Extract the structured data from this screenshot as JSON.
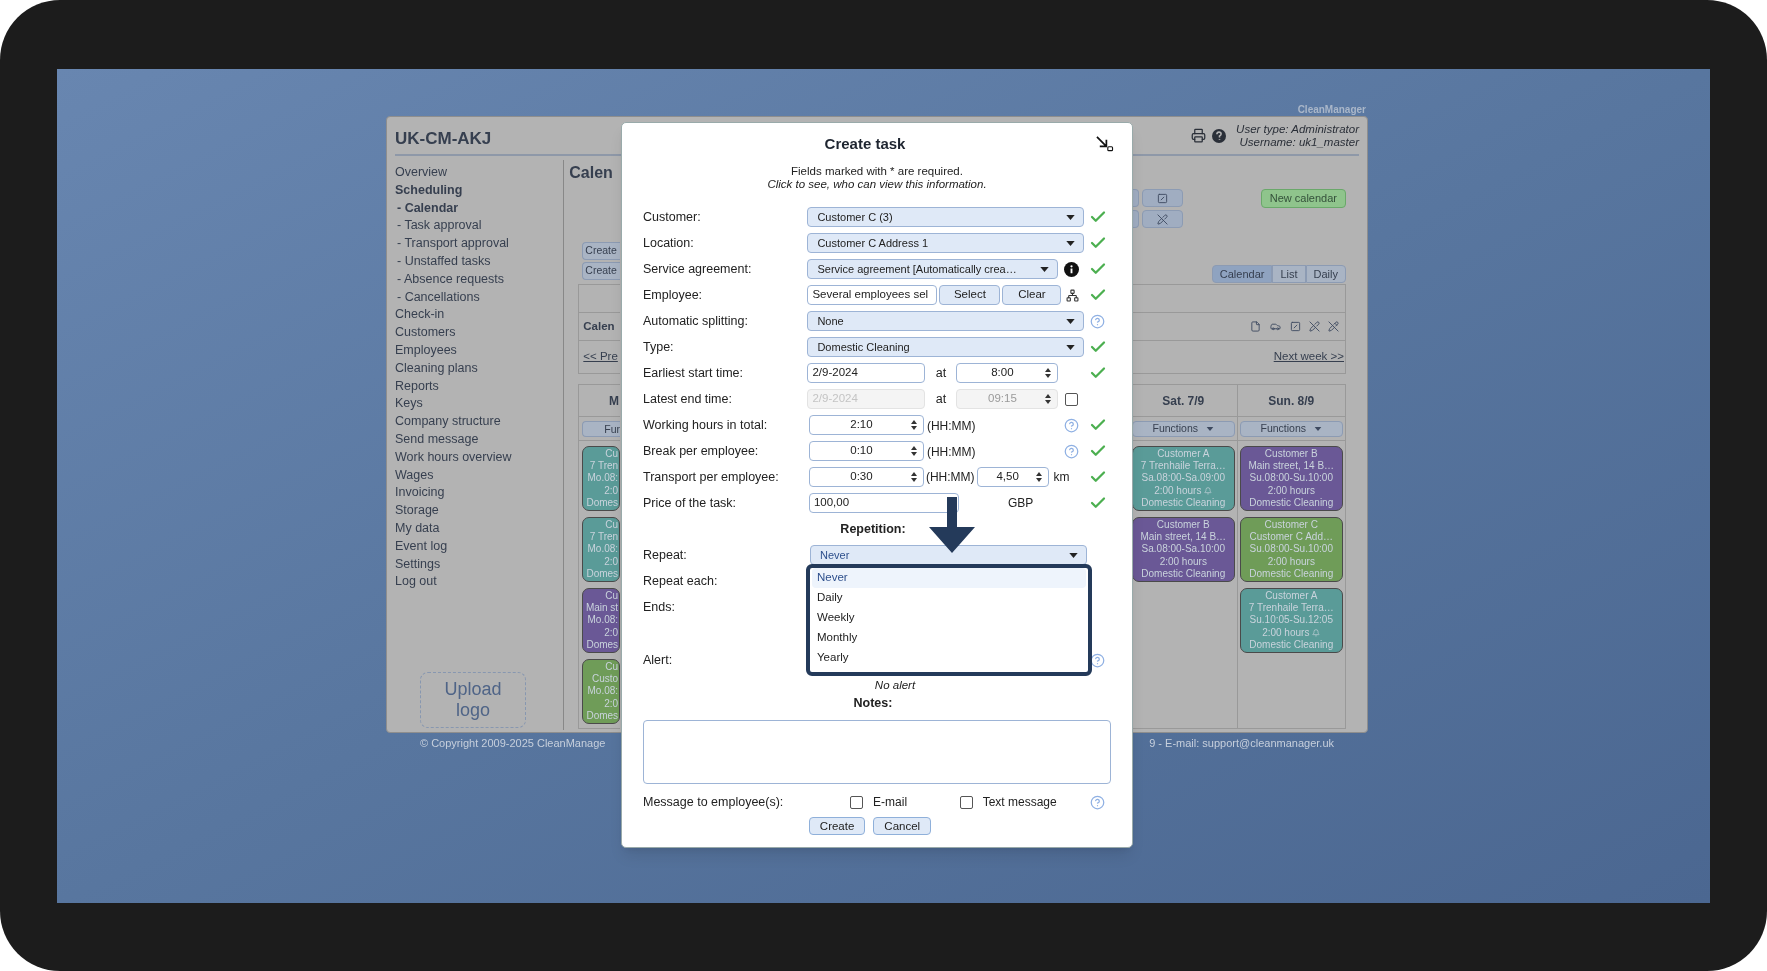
{
  "brand": "CleanManager",
  "app": {
    "title": "UK-CM-AKJ",
    "user_type": "User type: Administrator",
    "username": "Username: uk1_master"
  },
  "sidebar": {
    "items": [
      {
        "label": "Overview",
        "selected": false
      },
      {
        "label": "Scheduling",
        "selected": true,
        "children": [
          {
            "label": "- Calendar",
            "selected": true
          },
          {
            "label": "- Task approval",
            "selected": false
          },
          {
            "label": "- Transport approval",
            "selected": false
          },
          {
            "label": "- Unstaffed tasks",
            "selected": false
          },
          {
            "label": "- Absence requests",
            "selected": false
          },
          {
            "label": "- Cancellations",
            "selected": false
          }
        ]
      },
      {
        "label": "Check-in",
        "selected": false
      },
      {
        "label": "Customers",
        "selected": false
      },
      {
        "label": "Employees",
        "selected": false
      },
      {
        "label": "Cleaning plans",
        "selected": false
      },
      {
        "label": "Reports",
        "selected": false
      },
      {
        "label": "Keys",
        "selected": false
      },
      {
        "label": "Company structure",
        "selected": false
      },
      {
        "label": "Send message",
        "selected": false
      },
      {
        "label": "Work hours overview",
        "selected": false
      },
      {
        "label": "Wages",
        "selected": false
      },
      {
        "label": "Invoicing",
        "selected": false
      },
      {
        "label": "Storage",
        "selected": false
      },
      {
        "label": "My data",
        "selected": false
      },
      {
        "label": "Event log",
        "selected": false
      },
      {
        "label": "Settings",
        "selected": false
      },
      {
        "label": "Log out",
        "selected": false
      }
    ],
    "upload_logo": "Upload logo"
  },
  "calendar_left": {
    "heading": "Calen",
    "create_buttons": [
      "Create",
      "Create"
    ],
    "box_title": "Calen",
    "prev_link": "<< Pre",
    "day_header": "M",
    "functions": "Fur",
    "cards": [
      {
        "name": "Cu",
        "address": "7 Tren",
        "time": "Mo.08:",
        "hours": "2:0",
        "type": "Domes",
        "color": "#5a9b98"
      },
      {
        "name": "Cu",
        "address": "7 Tren",
        "time": "Mo.08:",
        "hours": "2:0",
        "type": "Domes",
        "color": "#5a9b98"
      },
      {
        "name": "Cu",
        "address": "Main st",
        "time": "Mo.08:",
        "hours": "2:0",
        "type": "Domes",
        "color": "#6a5896"
      },
      {
        "name": "Cu",
        "address": "Custo",
        "time": "Mo.08:",
        "hours": "2:0",
        "type": "Domes",
        "color": "#6f9c58"
      }
    ]
  },
  "calendar_right": {
    "new_calendar": "New calendar",
    "view_tabs": [
      {
        "label": "Calendar",
        "selected": true
      },
      {
        "label": "List",
        "selected": false
      },
      {
        "label": "Daily",
        "selected": false
      }
    ],
    "next_link": "Next week >>",
    "days": [
      {
        "header": "Sat. 7/9",
        "functions": "Functions",
        "cards": [
          {
            "name": "Customer A",
            "address": "7 Trenhaile Terra…",
            "time": "Sa.08:00-Sa.09:00",
            "hours": "2:00 hours",
            "alert": true,
            "type": "Domestic Cleaning",
            "color": "#5a9b98"
          },
          {
            "name": "Customer B",
            "address": "Main street, 14 B…",
            "time": "Sa.08:00-Sa.10:00",
            "hours": "2:00 hours",
            "alert": false,
            "type": "Domestic Cleaning",
            "color": "#6a5896"
          }
        ]
      },
      {
        "header": "Sun. 8/9",
        "functions": "Functions",
        "cards": [
          {
            "name": "Customer B",
            "address": "Main street, 14 B…",
            "time": "Su.08:00-Su.10:00",
            "hours": "2:00 hours",
            "alert": false,
            "type": "Domestic Cleaning",
            "color": "#6a5896"
          },
          {
            "name": "Customer C",
            "address": "Customer C Add…",
            "time": "Su.08:00-Su.10:00",
            "hours": "2:00 hours",
            "alert": false,
            "type": "Domestic Cleaning",
            "color": "#6f9c58"
          },
          {
            "name": "Customer A",
            "address": "7 Trenhaile Terra…",
            "time": "Su.10:05-Su.12:05",
            "hours": "2:00 hours",
            "alert": true,
            "type": "Domestic Cleaning",
            "color": "#5a9b98"
          }
        ]
      }
    ]
  },
  "footer": {
    "left": "© Copyright 2009-2025 CleanManage",
    "right": "9 - E-mail: support@cleanmanager.uk"
  },
  "dialog": {
    "title": "Create task",
    "note": "Fields marked with * are required.",
    "note_italic": "Click to see, who can view this information.",
    "fields": [
      {
        "kind": "select",
        "label": "Customer:",
        "value": "Customer C (3)",
        "info": false,
        "help": false,
        "valid": true
      },
      {
        "kind": "select",
        "label": "Location:",
        "value": "Customer C Address 1",
        "info": false,
        "help": false,
        "valid": true
      },
      {
        "kind": "select",
        "label": "Service agreement:",
        "value": "Service agreement [Automatically crea…",
        "info": true,
        "help": false,
        "valid": true
      },
      {
        "kind": "employee",
        "label": "Employee:",
        "value": "Several employees sel",
        "buttons": [
          "Select",
          "Clear"
        ],
        "valid": true
      },
      {
        "kind": "select",
        "label": "Automatic splitting:",
        "value": "None",
        "info": false,
        "help": true,
        "valid": false
      },
      {
        "kind": "select",
        "label": "Type:",
        "value": "Domestic Cleaning",
        "info": false,
        "help": false,
        "valid": true
      },
      {
        "kind": "datetime",
        "label": "Earliest start time:",
        "date": "2/9-2024",
        "at": "at",
        "time": "8:00",
        "disabled": false,
        "valid": true
      },
      {
        "kind": "optional_datetime",
        "label": "Latest end time:",
        "date": "2/9-2024",
        "at": "at",
        "time": "09:15",
        "disabled": true,
        "checked": false,
        "valid": false
      },
      {
        "kind": "duration",
        "label": "Working hours in total:",
        "value": "2:10",
        "unit": "(HH:MM)",
        "help": true,
        "valid": true
      },
      {
        "kind": "duration",
        "label": "Break per employee:",
        "value": "0:10",
        "unit": "(HH:MM)",
        "help": true,
        "valid": true
      },
      {
        "kind": "transport",
        "label": "Transport per employee:",
        "value": "0:30",
        "unit": "(HH:MM)",
        "distance": "4,50",
        "distance_unit": "km",
        "valid": true
      },
      {
        "kind": "price",
        "label": "Price of the task:",
        "value": "100,00",
        "currency": "GBP",
        "valid": true
      }
    ],
    "repetition_heading": "Repetition:",
    "repeat": {
      "label": "Repeat:",
      "value": "Never",
      "options": [
        {
          "label": "Never",
          "selected": true
        },
        {
          "label": "Daily",
          "selected": false
        },
        {
          "label": "Weekly",
          "selected": false
        },
        {
          "label": "Monthly",
          "selected": false
        },
        {
          "label": "Yearly",
          "selected": false
        }
      ]
    },
    "repeat_each_label": "Repeat each:",
    "ends_label": "Ends:",
    "alert": {
      "label": "Alert:",
      "help": true,
      "value": "No alert"
    },
    "notes_heading": "Notes:",
    "message": {
      "label": "Message to employee(s):",
      "options": [
        {
          "label": "E-mail",
          "checked": false
        },
        {
          "label": "Text message",
          "checked": false
        }
      ],
      "help": true
    },
    "buttons": [
      "Create",
      "Cancel"
    ]
  }
}
